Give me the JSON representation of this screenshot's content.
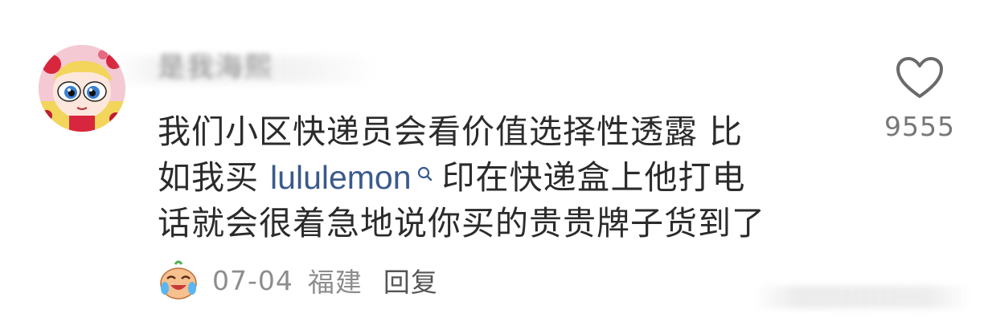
{
  "comment": {
    "username": "是我海熙",
    "lines": {
      "line1": "我们小区快递员会看价值选择性透露 比",
      "line2_before": "如我买 ",
      "line2_link": "lululemon",
      "line2_after": "印在快递盒上他打电",
      "line3": "话就会很着急地说你买的贵贵牌子货到了"
    },
    "date": "07-04",
    "location": "福建",
    "reply_label": "回复",
    "like_count": "9555",
    "icons": {
      "avatar": "powerpuff-avatar",
      "search": "search-icon",
      "emoji": "laughing-crying-emoji",
      "like": "heart-icon"
    },
    "colors": {
      "link": "#3a5a8c",
      "text": "#2b2b2b",
      "meta": "#8d8d8d"
    }
  }
}
